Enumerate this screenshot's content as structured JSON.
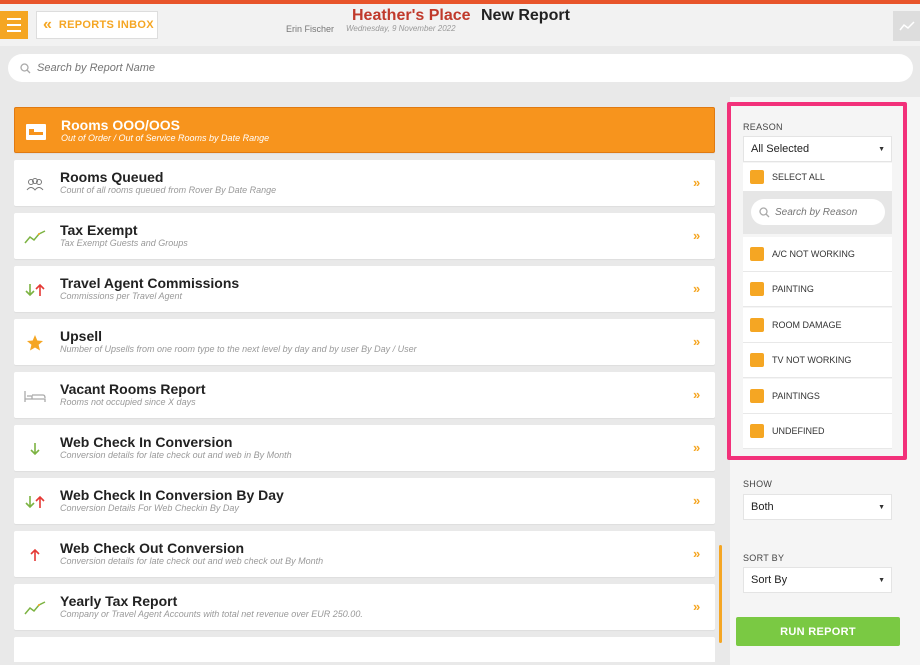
{
  "header": {
    "back_label": "REPORTS INBOX",
    "hotel_name": "Heather's Place",
    "title": "New Report",
    "user_name": "Erin Fischer",
    "date": "Wednesday, 9 November 2022"
  },
  "search": {
    "placeholder": "Search by Report Name"
  },
  "reports": [
    {
      "title": "Rooms OOO/OOS",
      "subtitle": "Out of Order / Out of Service Rooms by Date Range",
      "icon": "bed-icon",
      "selected": true
    },
    {
      "title": "Rooms Queued",
      "subtitle": "Count of all rooms queued from Rover By Date Range",
      "icon": "group-icon"
    },
    {
      "title": "Tax Exempt",
      "subtitle": "Tax Exempt Guests and Groups",
      "icon": "trend-icon"
    },
    {
      "title": "Travel Agent Commissions",
      "subtitle": "Commissions per Travel Agent",
      "icon": "up-down-arrows-icon"
    },
    {
      "title": "Upsell",
      "subtitle": "Number of Upsells from one room type to the next level by day and by user By Day / User",
      "icon": "star-icon"
    },
    {
      "title": "Vacant Rooms Report",
      "subtitle": "Rooms not occupied since X days",
      "icon": "bed-outline-icon"
    },
    {
      "title": "Web Check In Conversion",
      "subtitle": "Conversion details for late check out and web in By Month",
      "icon": "down-arrow-icon"
    },
    {
      "title": "Web Check In Conversion By Day",
      "subtitle": "Conversion Details For Web Checkin By Day",
      "icon": "up-down-arrows-icon"
    },
    {
      "title": "Web Check Out Conversion",
      "subtitle": "Conversion details for late check out and web check out By Month",
      "icon": "up-arrow-icon"
    },
    {
      "title": "Yearly Tax Report",
      "subtitle": "Company or Travel Agent Accounts with total net revenue over EUR 250.00.",
      "icon": "trend-icon"
    }
  ],
  "filters": {
    "reason": {
      "label": "REASON",
      "value": "All Selected",
      "select_all_label": "SELECT ALL",
      "search_placeholder": "Search by Reason",
      "options": [
        "A/C NOT WORKING",
        "PAINTING",
        "ROOM DAMAGE",
        "TV NOT WORKING",
        "PAINTINGS",
        "UNDEFINED"
      ]
    },
    "show": {
      "label": "SHOW",
      "value": "Both"
    },
    "sort_by": {
      "label": "SORT BY",
      "value": "Sort By"
    }
  },
  "run_button_label": "RUN REPORT",
  "colors": {
    "accent": "#f5a623",
    "hotel": "#c0392b",
    "highlight": "#f2317a",
    "run": "#7ac943",
    "up": "#e53935",
    "down": "#7cb342"
  }
}
